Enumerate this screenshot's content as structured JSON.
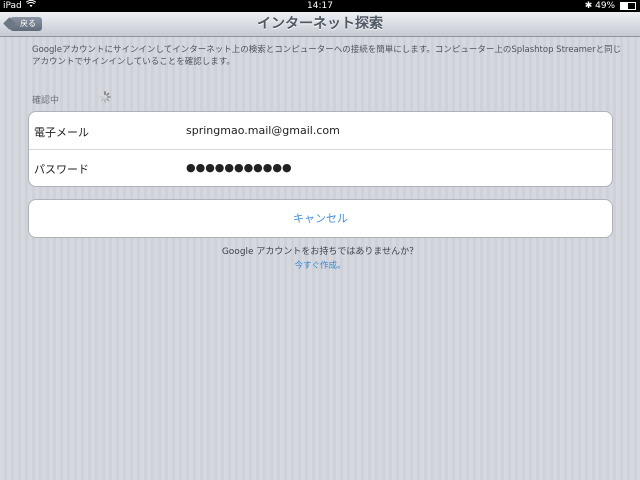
{
  "status_bar": {
    "device": "iPad",
    "time": "14:17",
    "battery": "49%",
    "battery_level": 0.49,
    "icons": [
      "wifi-icon",
      "bluetooth-icon",
      "battery-icon"
    ]
  },
  "nav": {
    "back_label": "戻る",
    "title": "インターネット探索"
  },
  "description": "Googleアカウントにサインインしてインターネット上の検索とコンピューターへの接続を簡単にします。コンピューター上のSplashtop Streamerと同じアカウントでサインインしていることを確認します。",
  "status": {
    "label": "確認中",
    "icon": "spinner-icon"
  },
  "form": {
    "email_label": "電子メール",
    "email_value": "springmao.mail@gmail.com",
    "password_label": "パスワード",
    "password_value": "●●●●●●●●●●●"
  },
  "cancel_label": "キャンセル",
  "prompt": "Google アカウントをお持ちではありませんか？",
  "create_link": "今すぐ作成。",
  "colors": {
    "link": "#3a86d4",
    "nav_title": "#4f5965",
    "status_bar": "#000000"
  }
}
